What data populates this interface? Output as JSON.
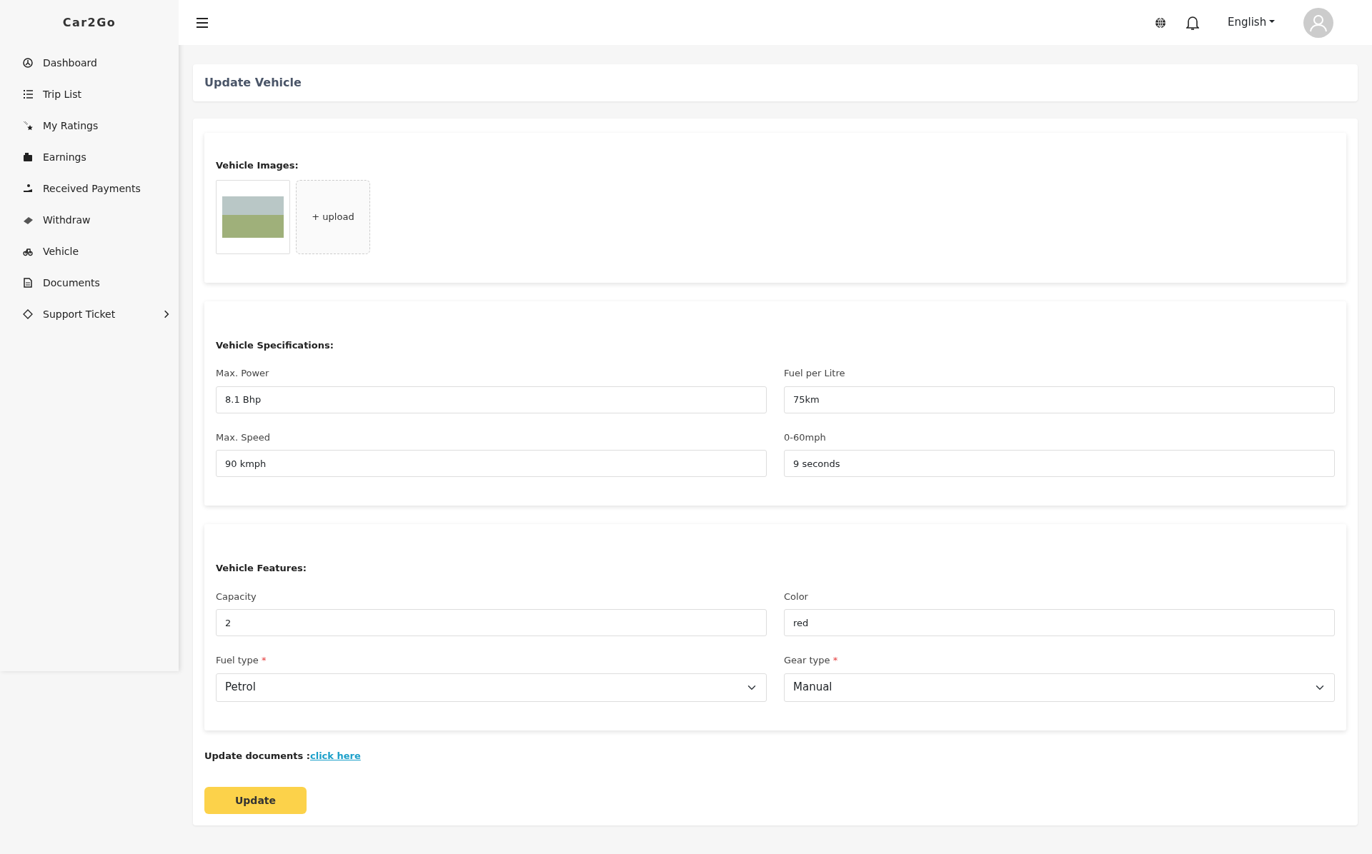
{
  "brand": "Car2Go",
  "sidebar": {
    "items": [
      {
        "label": "Dashboard",
        "kind": "link"
      },
      {
        "label": "Trip List",
        "kind": "link"
      },
      {
        "label": "My Ratings",
        "kind": "link"
      },
      {
        "label": "Earnings",
        "kind": "link"
      },
      {
        "label": "Received Payments",
        "kind": "link"
      },
      {
        "label": "Withdraw",
        "kind": "link"
      },
      {
        "label": "Vehicle",
        "kind": "link"
      },
      {
        "label": "Documents",
        "kind": "link"
      },
      {
        "label": "Support Ticket",
        "kind": "submenu"
      }
    ]
  },
  "topbar": {
    "language": "English"
  },
  "page_title": "Update Vehicle",
  "images": {
    "title": "Vehicle Images:",
    "upload": "+ upload"
  },
  "sections": [
    {
      "title": "Vehicle Specifications:",
      "fields": [
        {
          "label": "Max. Power",
          "kind": "text",
          "value": "8.1 Bhp"
        },
        {
          "label": "Fuel per Litre",
          "kind": "text",
          "value": "75km"
        },
        {
          "label": "Max. Speed",
          "kind": "text",
          "value": "90 kmph"
        },
        {
          "label": "0-60mph",
          "kind": "text",
          "value": "9 seconds"
        }
      ]
    },
    {
      "title": "Vehicle Features:",
      "fields": [
        {
          "label": "Capacity",
          "kind": "text",
          "value": "2"
        },
        {
          "label": "Color",
          "kind": "text",
          "value": "red"
        },
        {
          "label": "Fuel type",
          "kind": "select",
          "value": "Petrol",
          "required_mark": "*"
        },
        {
          "label": "Gear type",
          "kind": "select",
          "value": "Manual",
          "required_mark": "*"
        }
      ]
    }
  ],
  "documents": {
    "label": "Update documents :",
    "link": "click here"
  },
  "submit": "Update"
}
